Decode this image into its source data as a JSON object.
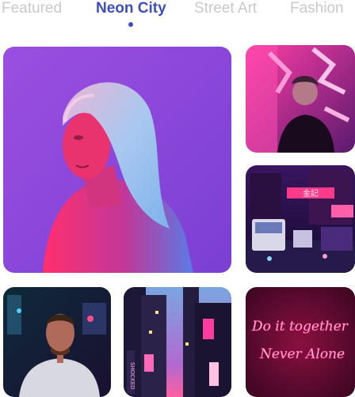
{
  "tabs": [
    {
      "label": "Featured",
      "active": false
    },
    {
      "label": "Neon City",
      "active": true
    },
    {
      "label": "Street Art",
      "active": false
    },
    {
      "label": "Fashion",
      "active": false
    }
  ],
  "gallery": {
    "sign_text_line1": "Do it together",
    "sign_text_line2": "Never Alone",
    "street_sign_text": "金記",
    "city_sign_text": "SHOCKED"
  },
  "colors": {
    "accent": "#3d4fbf",
    "tab_inactive": "#c9c9c9",
    "neon_pink": "#ff2d8a",
    "neon_purple": "#8a3df0",
    "neon_cyan": "#3ad7ff"
  }
}
